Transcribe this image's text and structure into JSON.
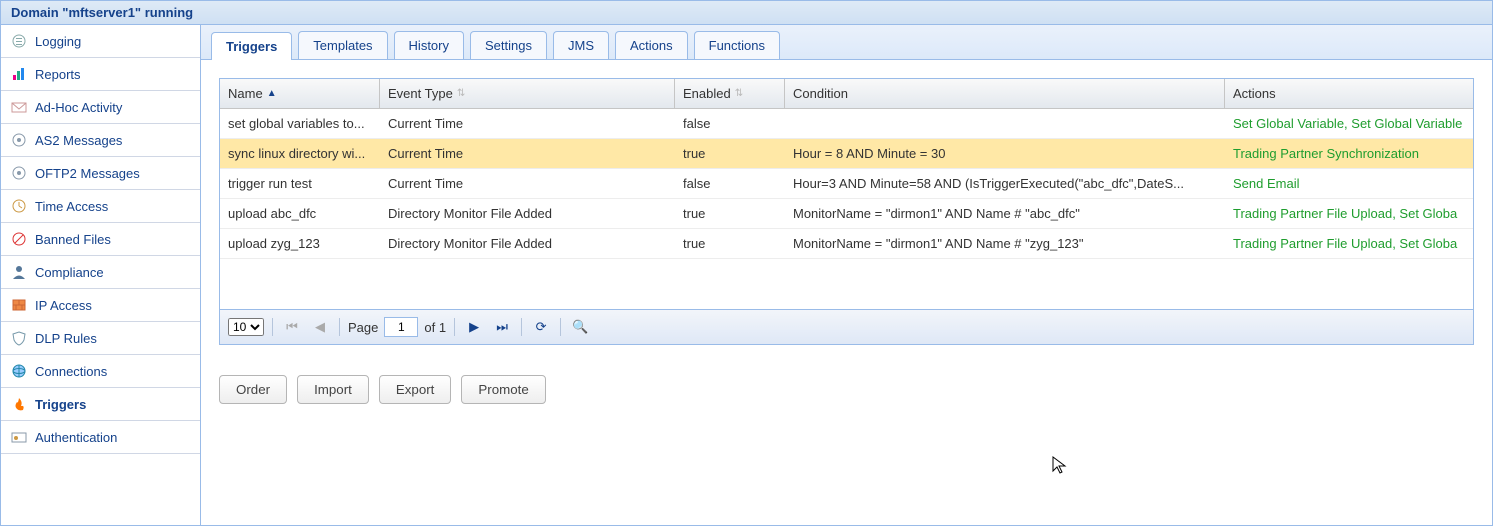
{
  "title": "Domain \"mftserver1\" running",
  "sidebar": {
    "items": [
      {
        "label": "Logging",
        "icon": "log"
      },
      {
        "label": "Reports",
        "icon": "chart"
      },
      {
        "label": "Ad-Hoc Activity",
        "icon": "mail"
      },
      {
        "label": "AS2 Messages",
        "icon": "msg"
      },
      {
        "label": "OFTP2 Messages",
        "icon": "msg"
      },
      {
        "label": "Time Access",
        "icon": "clock"
      },
      {
        "label": "Banned Files",
        "icon": "ban"
      },
      {
        "label": "Compliance",
        "icon": "user"
      },
      {
        "label": "IP Access",
        "icon": "wall"
      },
      {
        "label": "DLP Rules",
        "icon": "shield"
      },
      {
        "label": "Connections",
        "icon": "globe"
      },
      {
        "label": "Triggers",
        "icon": "fire",
        "active": true
      },
      {
        "label": "Authentication",
        "icon": "key"
      }
    ]
  },
  "tabs": [
    {
      "label": "Triggers",
      "active": true
    },
    {
      "label": "Templates"
    },
    {
      "label": "History"
    },
    {
      "label": "Settings"
    },
    {
      "label": "JMS"
    },
    {
      "label": "Actions"
    },
    {
      "label": "Functions"
    }
  ],
  "grid": {
    "headers": {
      "name": "Name",
      "event": "Event Type",
      "enabled": "Enabled",
      "condition": "Condition",
      "actions": "Actions"
    },
    "sort": {
      "column": "name",
      "dir": "asc"
    },
    "rows": [
      {
        "name": "set global variables to...",
        "event": "Current Time",
        "enabled": "false",
        "condition": "",
        "actions": "Set Global Variable, Set Global Variable",
        "selected": false
      },
      {
        "name": "sync linux directory wi...",
        "event": "Current Time",
        "enabled": "true",
        "condition": "Hour = 8 AND Minute = 30",
        "actions": "Trading Partner Synchronization",
        "selected": true
      },
      {
        "name": "trigger run test",
        "event": "Current Time",
        "enabled": "false",
        "condition": "Hour=3 AND Minute=58 AND (IsTriggerExecuted(\"abc_dfc\",DateS...",
        "actions": "Send Email",
        "selected": false
      },
      {
        "name": "upload abc_dfc",
        "event": "Directory Monitor File Added",
        "enabled": "true",
        "condition": "MonitorName = \"dirmon1\" AND Name # \"abc_dfc\"",
        "actions": "Trading Partner File Upload, Set Globa",
        "selected": false
      },
      {
        "name": "upload zyg_123",
        "event": "Directory Monitor File Added",
        "enabled": "true",
        "condition": "MonitorName = \"dirmon1\" AND Name # \"zyg_123\"",
        "actions": "Trading Partner File Upload, Set Globa",
        "selected": false
      }
    ]
  },
  "pager": {
    "page_size": "10",
    "page_label": "Page",
    "page": "1",
    "of_label": "of 1"
  },
  "buttons": {
    "order": "Order",
    "import": "Import",
    "export": "Export",
    "promote": "Promote"
  }
}
